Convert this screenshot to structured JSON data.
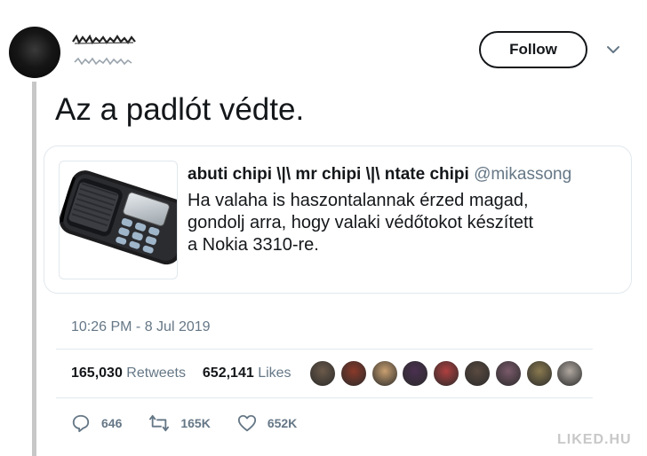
{
  "tweet": {
    "text": "Az a padlót védte.",
    "follow_label": "Follow",
    "timestamp": "10:26 PM - 8 Jul 2019",
    "retweets_count": "165,030",
    "retweets_label": "Retweets",
    "likes_count": "652,141",
    "likes_label": "Likes"
  },
  "quoted_tweet": {
    "name": "abuti chipi \\|\\ mr chipi \\|\\ ntate chipi",
    "handle": "@mikassong",
    "lines": [
      "Ha valaha is haszontalannak érzed magad,",
      "gondolj arra, hogy valaki védőtokot készített",
      "a Nokia 3310-re."
    ],
    "image_icon": "nokia-phone-in-case"
  },
  "liker_colors": [
    "#6b5a4a",
    "#8a3a2a",
    "#c9a070",
    "#4a3050",
    "#b04040",
    "#5a4a40",
    "#7a5a6a",
    "#8a7a50",
    "#b0a8a0"
  ],
  "actions": {
    "reply_count": "646",
    "retweet_count": "165K",
    "like_count": "652K"
  },
  "icons": {
    "reply": "reply-icon",
    "retweet": "retweet-icon",
    "like": "heart-icon",
    "caret": "chevron-down-icon"
  },
  "watermark": "LIKED.HU"
}
